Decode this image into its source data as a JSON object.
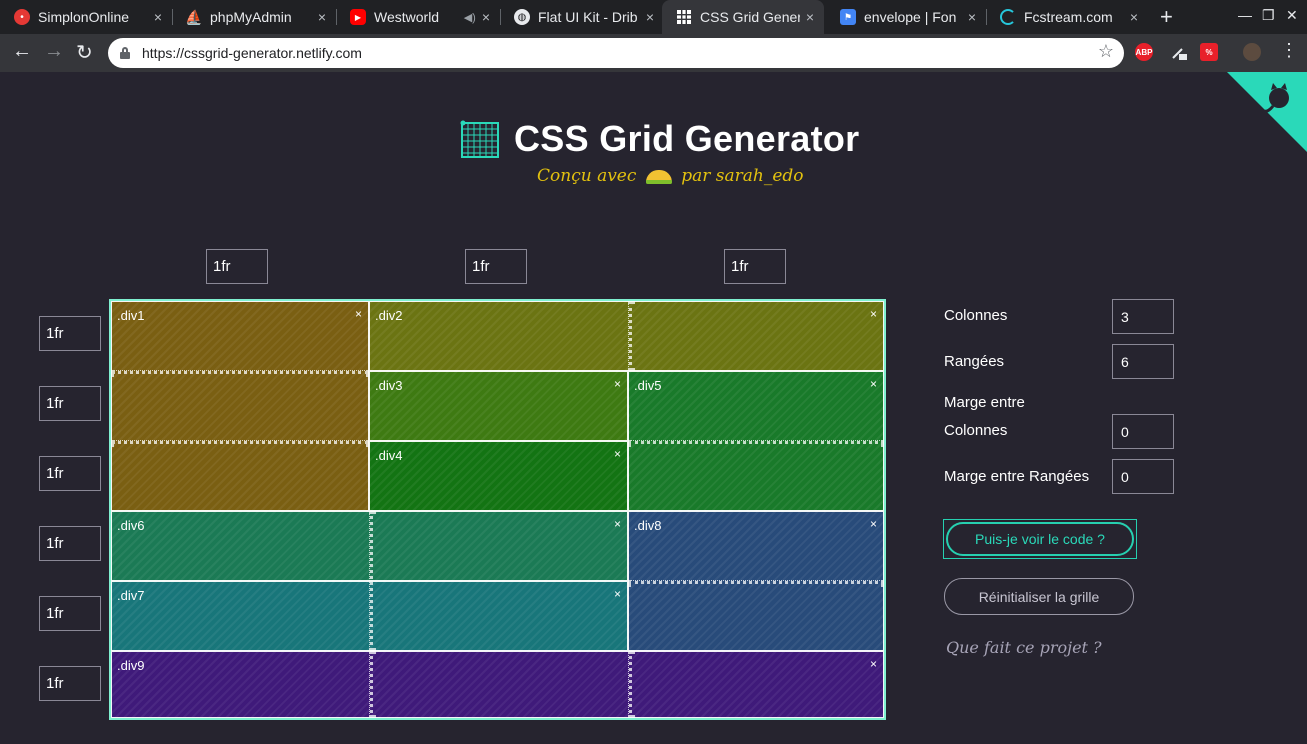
{
  "browser": {
    "tabs": [
      {
        "title": "SimplonOnline",
        "favicon": "simplon-icon",
        "color": "#e53935"
      },
      {
        "title": "phpMyAdmin",
        "favicon": "phpmyadmin-icon",
        "color": "#f29111"
      },
      {
        "title": "Westworld",
        "favicon": "youtube-icon",
        "color": "#ff0000"
      },
      {
        "title": "Flat UI Kit - Drib",
        "favicon": "globe-icon",
        "color": "#e8eaed"
      },
      {
        "title": "CSS Grid Gener",
        "favicon": "grid-icon",
        "color": "#ffffff"
      },
      {
        "title": "envelope | Fon",
        "favicon": "flag-icon",
        "color": "#4285f4"
      },
      {
        "title": "Fcstream.com",
        "favicon": "loading-icon",
        "color": "#26c6da"
      }
    ],
    "url": "https://cssgrid-generator.netlify.com"
  },
  "page": {
    "title": "CSS Grid Generator",
    "subtitle_prefix": "Conçu avec",
    "subtitle_suffix": "par sarah_edo"
  },
  "columns": [
    "1fr",
    "1fr",
    "1fr"
  ],
  "rows": [
    "1fr",
    "1fr",
    "1fr",
    "1fr",
    "1fr",
    "1fr"
  ],
  "areas": [
    {
      "name": ".div1",
      "color": "#7a5f12"
    },
    {
      "name": ".div2",
      "color": "#6b7412"
    },
    {
      "name": ".div3",
      "color": "#3e7a12"
    },
    {
      "name": ".div4",
      "color": "#137413"
    },
    {
      "name": ".div5",
      "color": "#197a2a"
    },
    {
      "name": ".div6",
      "color": "#1b7a55"
    },
    {
      "name": ".div7",
      "color": "#18767a"
    },
    {
      "name": ".div8",
      "color": "#284b7a"
    },
    {
      "name": ".div9",
      "color": "#3f1a7a"
    }
  ],
  "close_glyph": "×",
  "controls": {
    "columns_label": "Colonnes",
    "columns_value": "3",
    "rows_label": "Rangées",
    "rows_value": "6",
    "col_gap_label_1": "Marge entre",
    "col_gap_label_2": "Colonnes",
    "col_gap_value": "0",
    "row_gap_label": "Marge entre Rangées",
    "row_gap_value": "0",
    "code_button": "Puis-je voir le code ?",
    "reset_button": "Réinitialiser la grille",
    "what_link": "Que fait ce projet ?"
  }
}
